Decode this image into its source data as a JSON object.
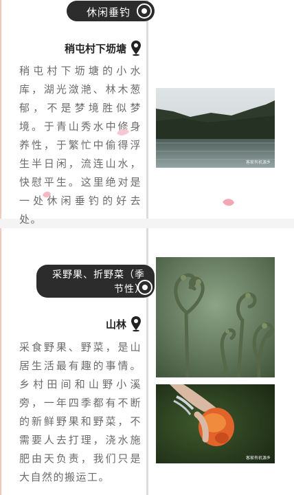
{
  "section1": {
    "tag_label": "休闲垂钓",
    "location_label": "稍屯村下坜塘",
    "paragraph": "稍屯村下坜塘的小水库，湖光潋滟、林木葱郁，不是梦境胜似梦境。于青山秀水中修身养性，于繁忙中偷得浮生半日闲，流连山水，快慰平生。这里绝对是一处休闲垂钓的好去处。",
    "photo_watermark": "客家有机源乡",
    "photo_icon": "lake-photo"
  },
  "section2": {
    "tag_label": "采野果、折野菜（季节性）",
    "location_label": "山林",
    "paragraph": "采食野果、野菜，是山居生活最有趣的事情。乡村田间和山野小溪旁，一年四季都有不断的新鲜野果和野菜，不需要人去打理，浇水施肥由天负责，我们只是大自然的搬运工。",
    "photo1_icon": "fern-photo",
    "photo2_icon": "wild-fruit-photo",
    "photo2_watermark": "客家有机源乡"
  },
  "colors": {
    "tag_bg": "#2c2c2c",
    "text": "#6b6b6b",
    "divider": "#dcdcdc"
  }
}
